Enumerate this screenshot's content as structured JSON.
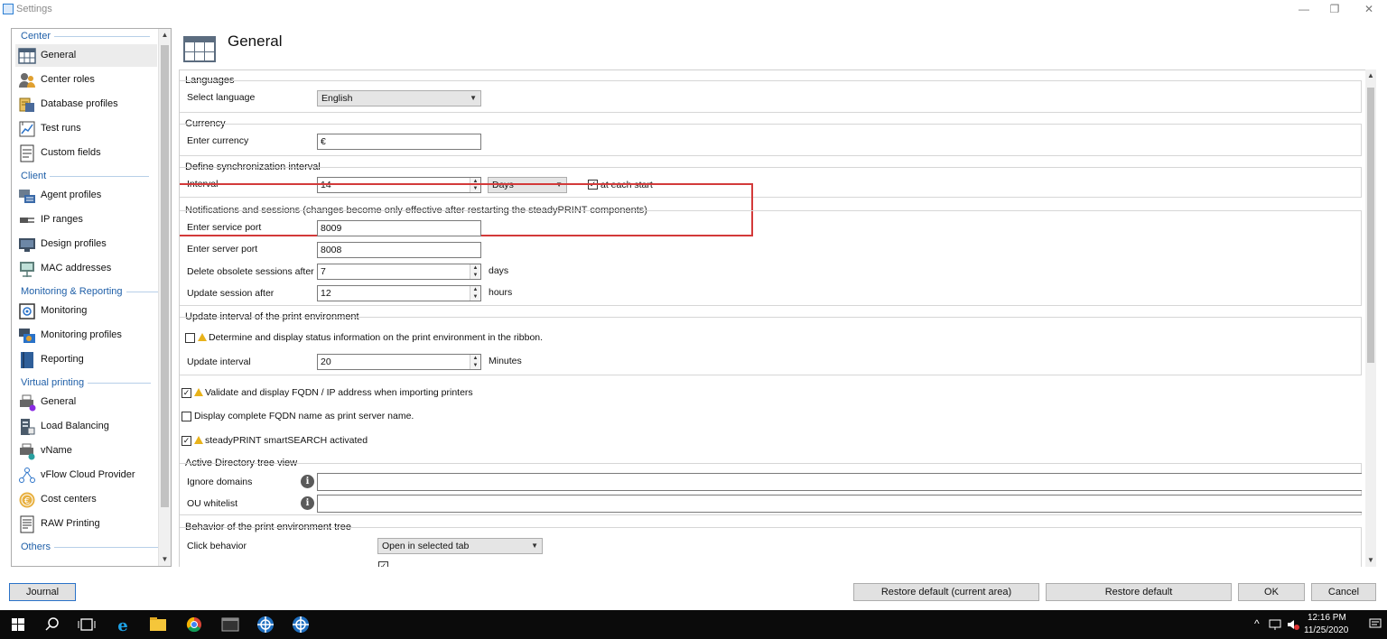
{
  "window": {
    "title": "Settings",
    "controls": {
      "minimize": "—",
      "restore": "❐",
      "close": "✕"
    }
  },
  "nav": {
    "sections": [
      {
        "label": "Center",
        "items": [
          "General",
          "Center roles",
          "Database profiles",
          "Test runs",
          "Custom fields"
        ]
      },
      {
        "label": "Client",
        "items": [
          "Agent profiles",
          "IP ranges",
          "Design profiles",
          "MAC addresses"
        ]
      },
      {
        "label": "Monitoring & Reporting",
        "items": [
          "Monitoring",
          "Monitoring profiles",
          "Reporting"
        ]
      },
      {
        "label": "Virtual printing",
        "items": [
          "General",
          "Load Balancing",
          "vName",
          "vFlow Cloud Provider",
          "Cost centers",
          "RAW Printing"
        ]
      },
      {
        "label": "Others",
        "items": []
      }
    ],
    "selected": "General",
    "scroll_up": "▲",
    "scroll_down": "▼"
  },
  "page": {
    "title": "General",
    "languages": {
      "group": "Languages",
      "label": "Select language",
      "value": "English"
    },
    "currency": {
      "group": "Currency",
      "label": "Enter currency",
      "value": "€"
    },
    "sync": {
      "group": "Define synchronization interval",
      "label": "Interval",
      "value": "14",
      "unit": "Days",
      "at_each_start": "at each start",
      "checked": true
    },
    "notifications": {
      "group": "Notifications and sessions (changes become only effective after restarting the steadyPRINT components)",
      "service_port_label": "Enter service port",
      "service_port": "8009",
      "server_port_label": "Enter server port",
      "server_port": "8008",
      "delete_sessions_label": "Delete obsolete sessions after",
      "delete_sessions": "7",
      "delete_unit": "days",
      "update_session_label": "Update session after",
      "update_session": "12",
      "update_unit": "hours"
    },
    "update_env": {
      "group": "Update interval of the print environment",
      "determine_label": "Determine and display status information on the print environment in the ribbon.",
      "determine_checked": false,
      "interval_label": "Update interval",
      "interval": "20",
      "interval_unit": "Minutes"
    },
    "validate_fqdn": {
      "label": "Validate and display FQDN / IP address when importing printers",
      "checked": true
    },
    "display_fqdn": {
      "label": "Display complete FQDN name as print server name.",
      "checked": false
    },
    "smartsearch": {
      "label": "steadyPRINT smartSEARCH activated",
      "checked": true
    },
    "ad_tree": {
      "group": "Active Directory tree view",
      "ignore_domains": "Ignore domains",
      "ou_whitelist": "OU whitelist",
      "info_glyph": "i"
    },
    "behavior": {
      "group": "Behavior of the print environment tree",
      "click_label": "Click behavior",
      "click_value": "Open in selected tab"
    },
    "check_mark": "✓"
  },
  "buttons": {
    "journal": "Journal",
    "restore_current": "Restore default (current area)",
    "restore_default": "Restore default",
    "ok": "OK",
    "cancel": "Cancel"
  },
  "taskbar": {
    "time": "12:16 PM",
    "date": "11/25/2020",
    "tray_chevron": "^"
  }
}
